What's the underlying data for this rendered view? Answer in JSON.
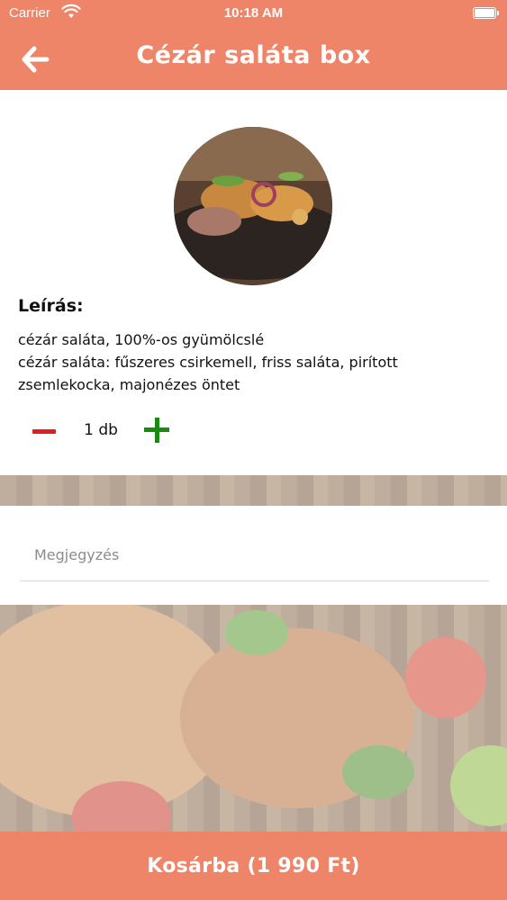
{
  "status_bar": {
    "carrier": "Carrier",
    "time": "10:18 AM",
    "wifi_icon": "wifi-icon",
    "battery_icon": "battery-icon"
  },
  "nav": {
    "back_icon": "arrow-left-icon",
    "title": "Cézár saláta box"
  },
  "product": {
    "image": "dish-photo",
    "description_label": "Leírás:",
    "description_lines": [
      "cézár saláta, 100%-os gyümölcslé",
      "cézár saláta: fűszeres csirkemell, friss saláta, pirított zsemlekocka, majonézes öntet"
    ]
  },
  "quantity": {
    "minus_icon": "minus-icon",
    "value": "1 db",
    "plus_icon": "plus-icon"
  },
  "note": {
    "placeholder": "Megjegyzés",
    "value": ""
  },
  "cart_button": {
    "label": "Kosárba (1 990 Ft)"
  },
  "colors": {
    "accent": "#ee8468",
    "minus": "#e0201e",
    "plus": "#1a8a10"
  }
}
